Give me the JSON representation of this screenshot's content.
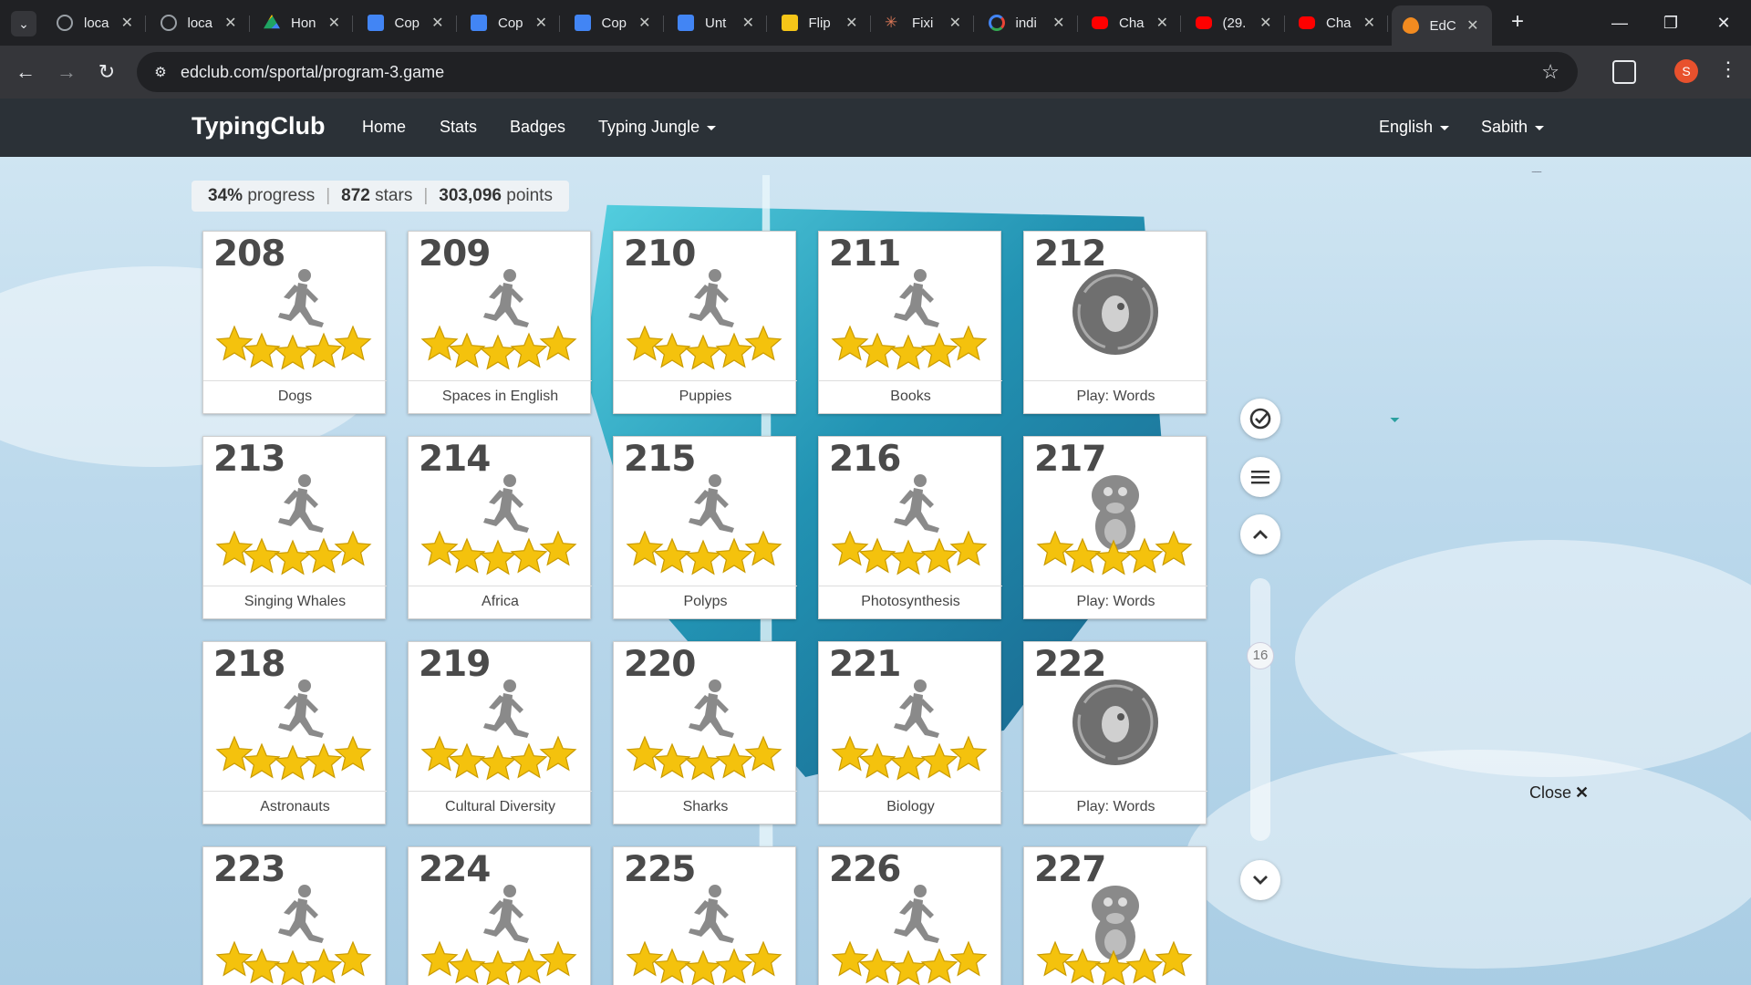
{
  "browser": {
    "tabs": [
      {
        "label": "loca",
        "color": "#9aa0a6",
        "shape": "globe"
      },
      {
        "label": "loca",
        "color": "#9aa0a6",
        "shape": "globe"
      },
      {
        "label": "Hon",
        "color": "#1fa463",
        "shape": "drive"
      },
      {
        "label": "Cop",
        "color": "#4285f4",
        "shape": "doc"
      },
      {
        "label": "Cop",
        "color": "#4285f4",
        "shape": "doc"
      },
      {
        "label": "Cop",
        "color": "#4285f4",
        "shape": "doc"
      },
      {
        "label": "Unt",
        "color": "#4285f4",
        "shape": "doc"
      },
      {
        "label": "Flip",
        "color": "#f5c518",
        "shape": "sq"
      },
      {
        "label": "Fixi",
        "color": "#d97757",
        "shape": "star"
      },
      {
        "label": "indi",
        "color": "#4285f4",
        "shape": "g"
      },
      {
        "label": "Cha",
        "color": "#ff0000",
        "shape": "yt"
      },
      {
        "label": "(29.",
        "color": "#ff0000",
        "shape": "yt"
      },
      {
        "label": "Cha",
        "color": "#ff0000",
        "shape": "yt"
      },
      {
        "label": "EdC",
        "color": "#f28b20",
        "shape": "flame",
        "active": true
      }
    ],
    "url": "edclub.com/sportal/program-3.game",
    "profile_initial": "S"
  },
  "site": {
    "brand": "TypingClub",
    "nav": [
      "Home",
      "Stats",
      "Badges",
      "Typing Jungle"
    ],
    "language": "English",
    "user": "Sabith"
  },
  "progress": {
    "percent_value": "34%",
    "percent_label": "progress",
    "stars_value": "872",
    "stars_label": "stars",
    "points_value": "303,096",
    "points_label": "points"
  },
  "lessons": [
    {
      "num": "208",
      "name": "Dogs",
      "kind": "runner",
      "stars": 5
    },
    {
      "num": "209",
      "name": "Spaces in English",
      "kind": "runner",
      "stars": 5
    },
    {
      "num": "210",
      "name": "Puppies",
      "kind": "runner",
      "stars": 5
    },
    {
      "num": "211",
      "name": "Books",
      "kind": "runner",
      "stars": 5
    },
    {
      "num": "212",
      "name": "Play: Words",
      "kind": "game",
      "stars": 0
    },
    {
      "num": "213",
      "name": "Singing Whales",
      "kind": "runner",
      "stars": 5
    },
    {
      "num": "214",
      "name": "Africa",
      "kind": "runner",
      "stars": 5
    },
    {
      "num": "215",
      "name": "Polyps",
      "kind": "runner",
      "stars": 5
    },
    {
      "num": "216",
      "name": "Photosynthesis",
      "kind": "runner",
      "stars": 5
    },
    {
      "num": "217",
      "name": "Play: Words",
      "kind": "monster",
      "stars": 5
    },
    {
      "num": "218",
      "name": "Astronauts",
      "kind": "runner",
      "stars": 5
    },
    {
      "num": "219",
      "name": "Cultural Diversity",
      "kind": "runner",
      "stars": 5
    },
    {
      "num": "220",
      "name": "Sharks",
      "kind": "runner",
      "stars": 5
    },
    {
      "num": "221",
      "name": "Biology",
      "kind": "runner",
      "stars": 5
    },
    {
      "num": "222",
      "name": "Play: Words",
      "kind": "game",
      "stars": 0
    },
    {
      "num": "223",
      "name": "",
      "kind": "runner",
      "stars": 5
    },
    {
      "num": "224",
      "name": "",
      "kind": "runner",
      "stars": 5
    },
    {
      "num": "225",
      "name": "",
      "kind": "runner",
      "stars": 5
    },
    {
      "num": "226",
      "name": "",
      "kind": "runner",
      "stars": 5
    },
    {
      "num": "227",
      "name": "",
      "kind": "monster",
      "stars": 5
    }
  ],
  "side": {
    "rail_number": "16",
    "close_label": "Close",
    "close_x": "✕"
  },
  "colors": {
    "star": "#f4c20d",
    "figure": "#8a8a8a",
    "nav_bg": "#2b3137"
  }
}
